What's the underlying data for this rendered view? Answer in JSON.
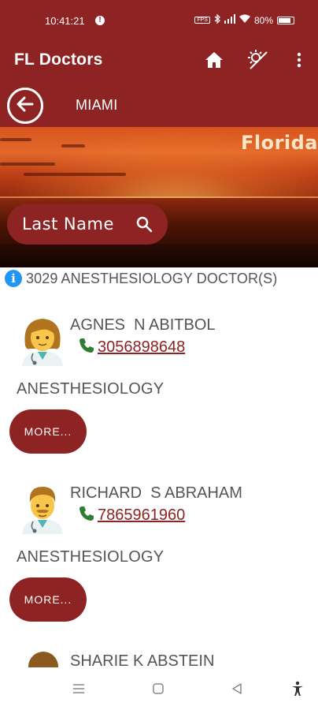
{
  "status_bar": {
    "time": "10:41:21",
    "notification_glyph": "!",
    "fps_tag": "FPS",
    "battery_percent": "80%"
  },
  "app_bar": {
    "title": "FL Doctors",
    "icons": [
      "home-icon",
      "theme-toggle-icon",
      "more-vert-icon"
    ]
  },
  "sub_bar": {
    "city": "MIAMI"
  },
  "banner": {
    "word": "Florida",
    "search_label": "Last Name"
  },
  "results": {
    "info_glyph": "i",
    "count_text": "3029 ANESTHESIOLOGY DOCTOR(S)"
  },
  "doctors": [
    {
      "name": "AGNES  N ABITBOL",
      "phone": "3056898648",
      "specialty": "ANESTHESIOLOGY",
      "more_label": "MORE..."
    },
    {
      "name": "RICHARD  S ABRAHAM",
      "phone": "7865961960",
      "specialty": "ANESTHESIOLOGY",
      "more_label": "MORE..."
    }
  ],
  "partial_next": {
    "name": "SHARIE  K ABSTEIN"
  },
  "colors": {
    "brand": "#8e2323",
    "info": "#2196f3",
    "phone_icon": "#2e7d32"
  },
  "nav_bar": {
    "icons": [
      "menu-icon",
      "home-square-icon",
      "back-triangle-icon",
      "accessibility-icon"
    ]
  }
}
